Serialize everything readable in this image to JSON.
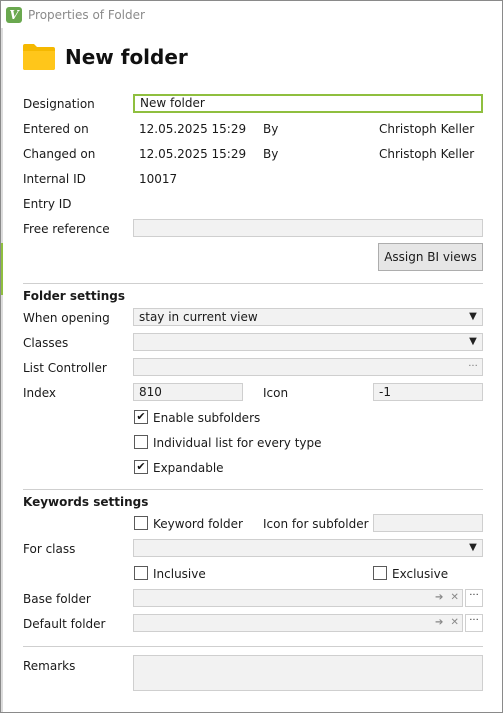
{
  "window": {
    "title": "Properties of Folder",
    "app_icon_letter": "V"
  },
  "header": {
    "title": "New folder"
  },
  "fields": {
    "designation_label": "Designation",
    "designation_value": "New folder",
    "entered_on_label": "Entered on",
    "entered_on_value": "12.05.2025 15:29",
    "entered_by_label": "By",
    "entered_by_value": "Christoph Keller",
    "changed_on_label": "Changed on",
    "changed_on_value": "12.05.2025 15:29",
    "changed_by_label": "By",
    "changed_by_value": "Christoph Keller",
    "internal_id_label": "Internal ID",
    "internal_id_value": "10017",
    "entry_id_label": "Entry ID",
    "free_reference_label": "Free reference",
    "free_reference_value": "",
    "assign_bi_views_button": "Assign BI views"
  },
  "folder_settings": {
    "section_title": "Folder settings",
    "when_opening_label": "When opening",
    "when_opening_value": "stay in current view",
    "classes_label": "Classes",
    "classes_value": "",
    "list_controller_label": "List Controller",
    "list_controller_value": "",
    "index_label": "Index",
    "index_value": "810",
    "icon_label": "Icon",
    "icon_value": "-1",
    "enable_subfolders_label": "Enable subfolders",
    "enable_subfolders_checked": true,
    "individual_list_label": "Individual list for every type",
    "individual_list_checked": false,
    "expandable_label": "Expandable",
    "expandable_checked": true
  },
  "keywords_settings": {
    "section_title": "Keywords settings",
    "keyword_folder_label": "Keyword folder",
    "keyword_folder_checked": false,
    "icon_for_subfolder_label": "Icon for subfolder",
    "icon_for_subfolder_value": "",
    "for_class_label": "For class",
    "for_class_value": "",
    "inclusive_label": "Inclusive",
    "inclusive_checked": false,
    "exclusive_label": "Exclusive",
    "exclusive_checked": false,
    "base_folder_label": "Base folder",
    "base_folder_value": "",
    "default_folder_label": "Default folder",
    "default_folder_value": ""
  },
  "remarks": {
    "label": "Remarks",
    "value": ""
  },
  "glyphs": {
    "dropdown": "▼",
    "check": "✔",
    "ellipsis": "···",
    "arrow_clear": "➔ ✕"
  },
  "colors": {
    "accent_green": "#8fbf3f",
    "folder_yellow": "#f5b800"
  }
}
